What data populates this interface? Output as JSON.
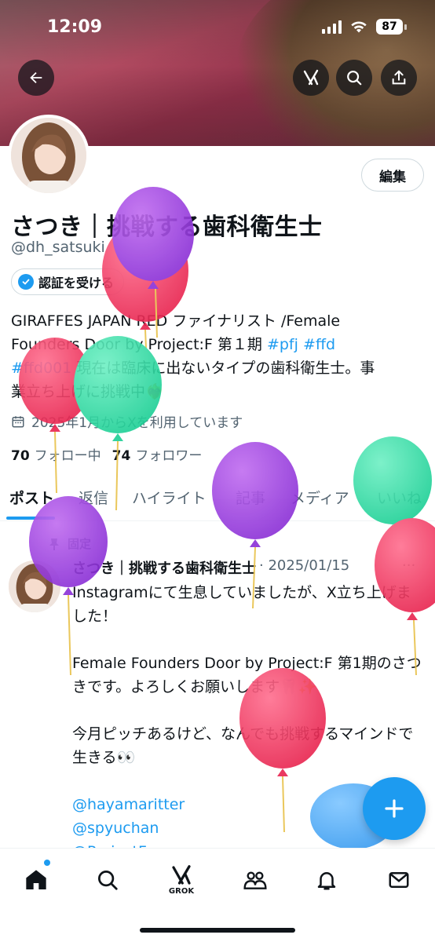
{
  "status_bar": {
    "time": "12:09",
    "battery": "87"
  },
  "profile": {
    "name": "さつき｜挑戦する歯科衛生士",
    "handle": "@dh_satsuki",
    "edit_label": "編集",
    "verify_label": "認証を受ける",
    "bio_line1": "GIRAFFES JAPAN RED ファイナリスト /Female",
    "bio_line2a": "Founders Door by Project:F 第１期 ",
    "bio_tag1": "#pfj",
    "bio_tag2": "#ffd",
    "bio_tag3": "#ffd001",
    "bio_line3": " 現在は臨床に出ないタイプの歯科衛生士。事",
    "bio_line4": "業立ち上げに挑戦中❤️‍🔥",
    "joined": "2025年1月からXを利用しています",
    "following_count": "70",
    "following_label": "フォロー中",
    "followers_count": "74",
    "followers_label": "フォロワー"
  },
  "tabs": [
    "ポスト",
    "返信",
    "ハイライト",
    "記事",
    "メディア",
    "いいね"
  ],
  "post": {
    "pinned_label": "固定",
    "author": "さつき｜挑戦する歯科衛生士",
    "date": "· 2025/01/15",
    "more": "···",
    "p1": "Instagramにて生息していましたが、X立ち上げました！",
    "p2": "Female Founders Door by Project:F 第1期のさつきです。よろしくお願いします🦷✨",
    "p3": "今月ピッチあるけど、なんでも挑戦するマインドで生きる👀",
    "mentions": [
      "@hayamaritter",
      "@spyuchan",
      "@ProjectF"
    ]
  },
  "bottom_nav": {
    "grok_label": "GROK"
  },
  "colors": {
    "accent": "#1d9bf0",
    "text": "#0f1419",
    "secondary": "#536471"
  }
}
